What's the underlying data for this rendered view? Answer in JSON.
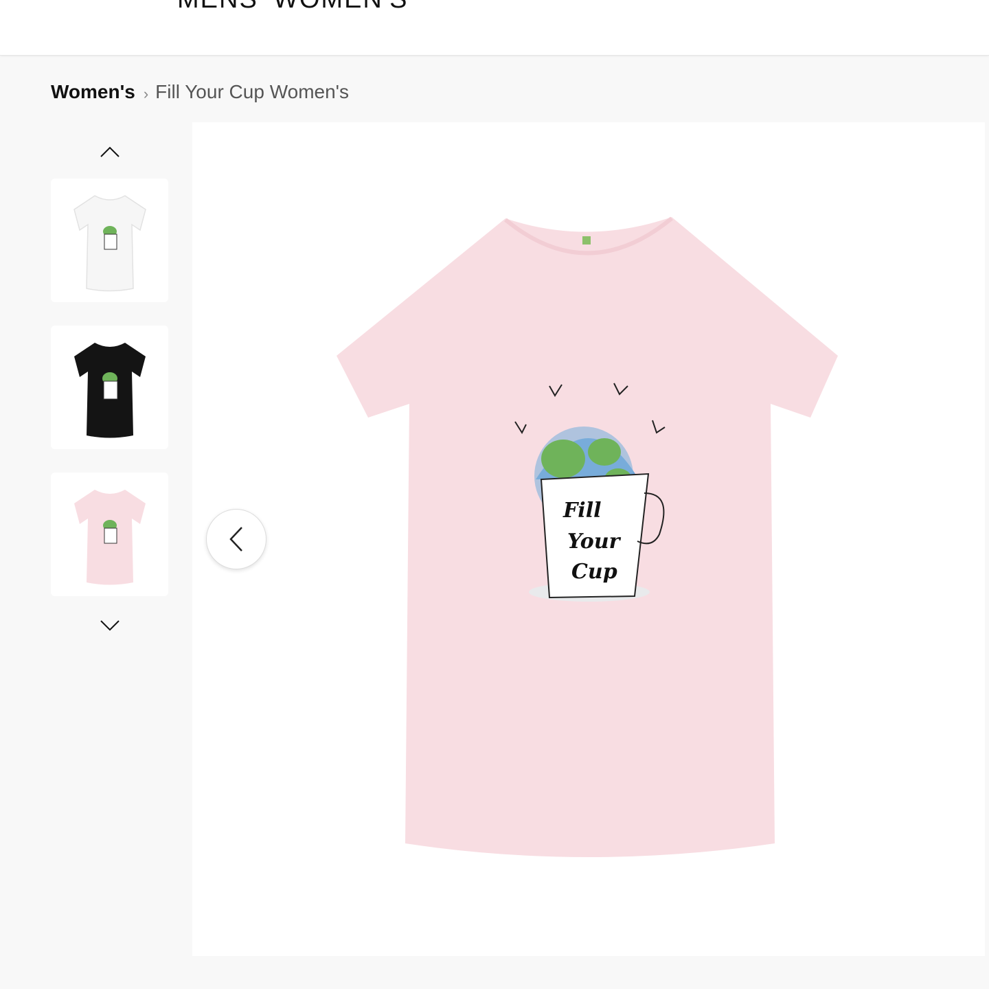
{
  "nav": {
    "mens": "MENS",
    "womens": "WOMEN'S"
  },
  "breadcrumb": {
    "parent": "Women's",
    "current": "Fill Your Cup Women's"
  },
  "product": {
    "print_line1": "Fill",
    "print_line2": "Your",
    "print_line3": "Cup"
  },
  "colors": {
    "pink_shirt": "#f8dde2",
    "white_shirt": "#f7f7f7",
    "black_shirt": "#141414",
    "globe_land": "#6fb35a",
    "globe_water": "#7fb3dc"
  },
  "icons": {
    "thumb_up": "chevron-up-icon",
    "thumb_down": "chevron-down-icon",
    "prev": "chevron-left-icon"
  }
}
